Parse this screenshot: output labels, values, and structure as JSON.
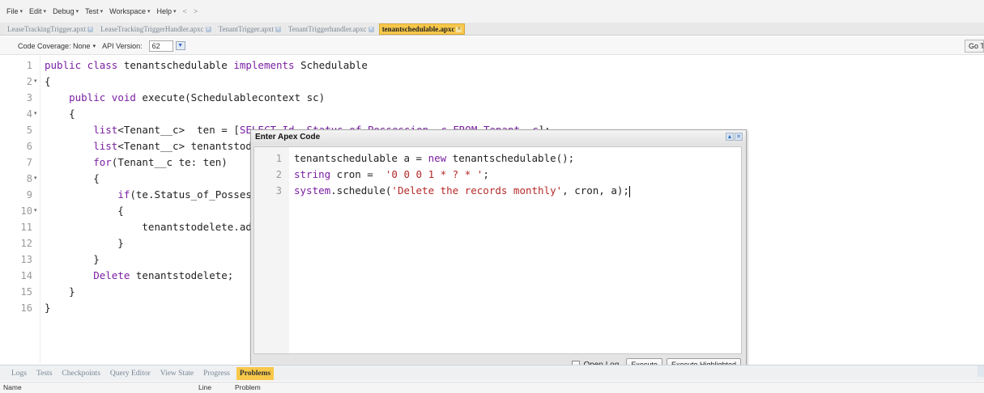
{
  "menubar": {
    "items": [
      "File",
      "Edit",
      "Debug",
      "Test",
      "Workspace",
      "Help"
    ],
    "back": "<",
    "forward": ">"
  },
  "tabs": [
    {
      "label": "LeaseTrackingTrigger.apxt",
      "active": false
    },
    {
      "label": "LeaseTrackingTriggerHandler.apxc",
      "active": false
    },
    {
      "label": "TenantTrigger.apxt",
      "active": false
    },
    {
      "label": "TenantTriggerhandler.apxc",
      "active": false
    },
    {
      "label": "tenantschedulable.apxc",
      "active": true
    }
  ],
  "toolbar": {
    "coverage": "Code Coverage: None",
    "api_label": "API Version:",
    "api_value": "62",
    "goto_label": "Go To"
  },
  "editor": {
    "lines": [
      {
        "num": "1",
        "fold": "",
        "html": "<span class=\"kw\">public class</span> tenantschedulable <span class=\"kw\">implements</span> Schedulable"
      },
      {
        "num": "2",
        "fold": "▾",
        "html": "{"
      },
      {
        "num": "3",
        "fold": "",
        "html": "    <span class=\"kw\">public void</span> execute(Schedulablecontext sc)"
      },
      {
        "num": "4",
        "fold": "▾",
        "html": "    {"
      },
      {
        "num": "5",
        "fold": "",
        "html": "        <span class=\"kw\">list</span>&lt;Tenant__c&gt;  ten = [<span class=\"kw\">SELECT Id, Status_of_Possession__c FROM Tenant__c</span>];"
      },
      {
        "num": "6",
        "fold": "",
        "html": "        <span class=\"kw\">list</span>&lt;Tenant__c&gt; tenantstodelete = <span class=\"kw\">new</span> list&lt;Tenant__c&gt;();"
      },
      {
        "num": "7",
        "fold": "",
        "html": "        <span class=\"kw\">for</span>(Tenant__c te: ten)"
      },
      {
        "num": "8",
        "fold": "▾",
        "html": "        {"
      },
      {
        "num": "9",
        "fold": "",
        "html": "            <span class=\"kw\">if</span>(te.Status_of_Possession__c == 'Vacated')"
      },
      {
        "num": "10",
        "fold": "▾",
        "html": "            {"
      },
      {
        "num": "11",
        "fold": "",
        "html": "                tenantstodelete.add(te);"
      },
      {
        "num": "12",
        "fold": "",
        "html": "            }"
      },
      {
        "num": "13",
        "fold": "",
        "html": "        }"
      },
      {
        "num": "14",
        "fold": "",
        "html": "        <span class=\"kw\">Delete</span> tenantstodelete;"
      },
      {
        "num": "15",
        "fold": "",
        "html": "    }"
      },
      {
        "num": "16",
        "fold": "",
        "html": "}"
      }
    ]
  },
  "dialog": {
    "title": "Enter Apex Code",
    "lines": [
      {
        "num": "1",
        "html": "tenantschedulable a = <span class=\"kw\">new</span> tenantschedulable();"
      },
      {
        "num": "2",
        "html": "<span class=\"kw\">string</span> cron =  <span class=\"str\">'0 0 0 1 * ? * '</span>;"
      },
      {
        "num": "3",
        "html": "<span class=\"kw\">system</span>.schedule(<span class=\"str\">'Delete the records monthly'</span>, cron, a);<span class=\"caret-bar\"></span>"
      }
    ],
    "open_log": "Open Log",
    "execute": "Execute",
    "execute_highlighted": "Execute Highlighted"
  },
  "bottom": {
    "tabs": [
      {
        "label": "Logs",
        "active": false
      },
      {
        "label": "Tests",
        "active": false
      },
      {
        "label": "Checkpoints",
        "active": false
      },
      {
        "label": "Query Editor",
        "active": false
      },
      {
        "label": "View State",
        "active": false
      },
      {
        "label": "Progress",
        "active": false
      },
      {
        "label": "Problems",
        "active": true
      }
    ],
    "headers": {
      "name": "Name",
      "line": "Line",
      "problem": "Problem"
    }
  }
}
